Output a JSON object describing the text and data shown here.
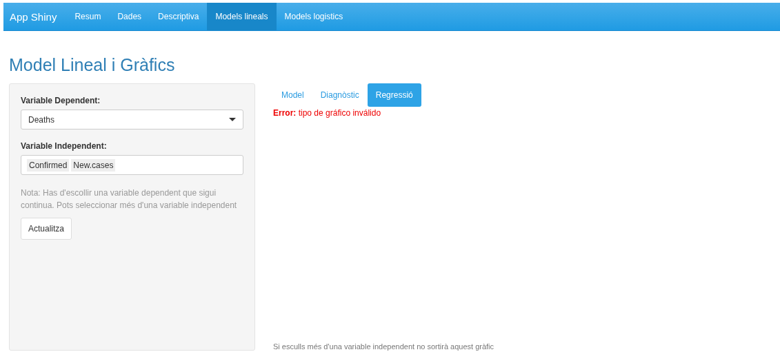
{
  "navbar": {
    "brand": "App Shiny",
    "items": [
      {
        "label": "Resum",
        "selected": false
      },
      {
        "label": "Dades",
        "selected": false
      },
      {
        "label": "Descriptiva",
        "selected": false
      },
      {
        "label": "Models lineals",
        "selected": true
      },
      {
        "label": "Models logistics",
        "selected": false
      }
    ]
  },
  "title": "Model Lineal i Gràfics",
  "sidebar": {
    "dependent_label": "Variable Dependent:",
    "dependent_value": "Deaths",
    "independent_label": "Variable Independent:",
    "independent_values": [
      "Confirmed",
      "New.cases"
    ],
    "note": "Nota: Has d'escollir una variable dependent que sigui continua. Pots seleccionar més d'una variable independent",
    "button": "Actualitza"
  },
  "tabs": [
    {
      "label": "Model",
      "selected": false
    },
    {
      "label": "Diagnòstic",
      "selected": false
    },
    {
      "label": "Regressió",
      "selected": true
    }
  ],
  "error": "**Error:** tipo de gráfico inválido",
  "footnote": "Si esculls més d'una variable independent no sortirà aquest gràfic"
}
